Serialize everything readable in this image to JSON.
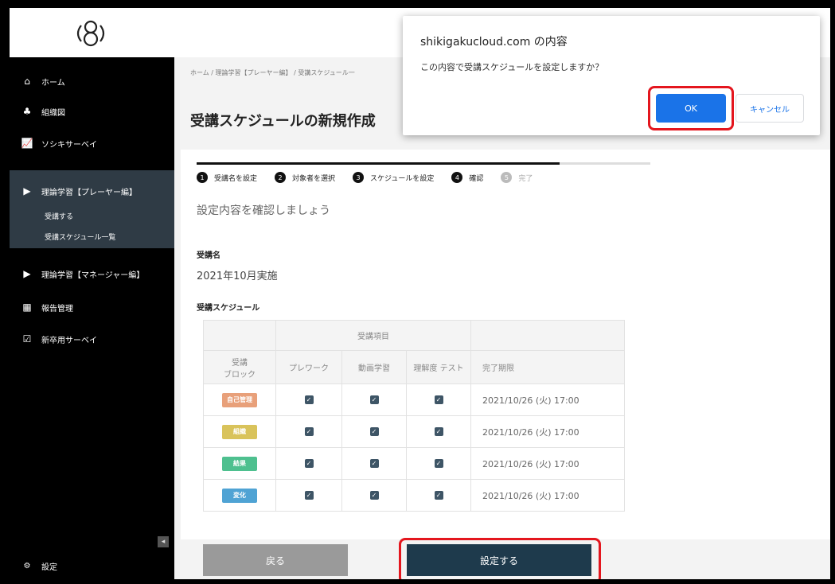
{
  "sidebar": {
    "items": [
      {
        "icon": "home-icon",
        "glyph": "⌂",
        "label": "ホーム"
      },
      {
        "icon": "org-chart-icon",
        "glyph": "♣",
        "label": "組織図"
      },
      {
        "icon": "chart-icon",
        "glyph": "📈",
        "label": "ソシキサーベイ"
      },
      {
        "icon": "play-icon",
        "glyph": "▶",
        "label": "理論学習【プレーヤー編】"
      },
      {
        "icon": "play-icon",
        "glyph": "▶",
        "label": "理論学習【マネージャー編】"
      },
      {
        "icon": "grid-icon",
        "glyph": "▦",
        "label": "報告管理"
      },
      {
        "icon": "survey-icon",
        "glyph": "☑",
        "label": "新卒用サーベイ"
      }
    ],
    "sub_items": [
      {
        "label": "受講する"
      },
      {
        "label": "受講スケジュール一覧"
      }
    ],
    "settings_label": "設定",
    "collapse_glyph": "◂"
  },
  "header": {
    "breadcrumb": "ホーム / 理論学習【プレーヤー編】 / 受講スケジュール一",
    "title": "受講スケジュールの新規作成"
  },
  "progress": 0.8,
  "steps": [
    {
      "num": "1",
      "label": "受講名を設定",
      "active": true
    },
    {
      "num": "2",
      "label": "対象者を選択",
      "active": true
    },
    {
      "num": "3",
      "label": "スケジュールを設定",
      "active": true
    },
    {
      "num": "4",
      "label": "確認",
      "active": true
    },
    {
      "num": "5",
      "label": "完了",
      "active": false
    }
  ],
  "main": {
    "confirm_msg": "設定内容を確認しましょう",
    "name_label": "受講名",
    "name_value": "2021年10月実施",
    "schedule_label": "受講スケジュール"
  },
  "table": {
    "group_header": "受講項目",
    "col_block": "受講\nブロック",
    "col_prework": "プレワーク",
    "col_video": "動画学習",
    "col_test": "理解度\nテスト",
    "col_due": "完了期限",
    "rows": [
      {
        "block": "自己管理",
        "color": "#e8a07a",
        "due": "2021/10/26 (火) 17:00"
      },
      {
        "block": "組織",
        "color": "#d9c35b",
        "due": "2021/10/26 (火) 17:00"
      },
      {
        "block": "結果",
        "color": "#4ec08f",
        "due": "2021/10/26 (火) 17:00"
      },
      {
        "block": "変化",
        "color": "#4fa3d4",
        "due": "2021/10/26 (火) 17:00"
      }
    ]
  },
  "buttons": {
    "back": "戻る",
    "set": "設定する"
  },
  "dialog": {
    "title": "shikigakucloud.com の内容",
    "message": "この内容で受講スケジュールを設定しますか？",
    "ok": "OK",
    "cancel": "キャンセル"
  }
}
